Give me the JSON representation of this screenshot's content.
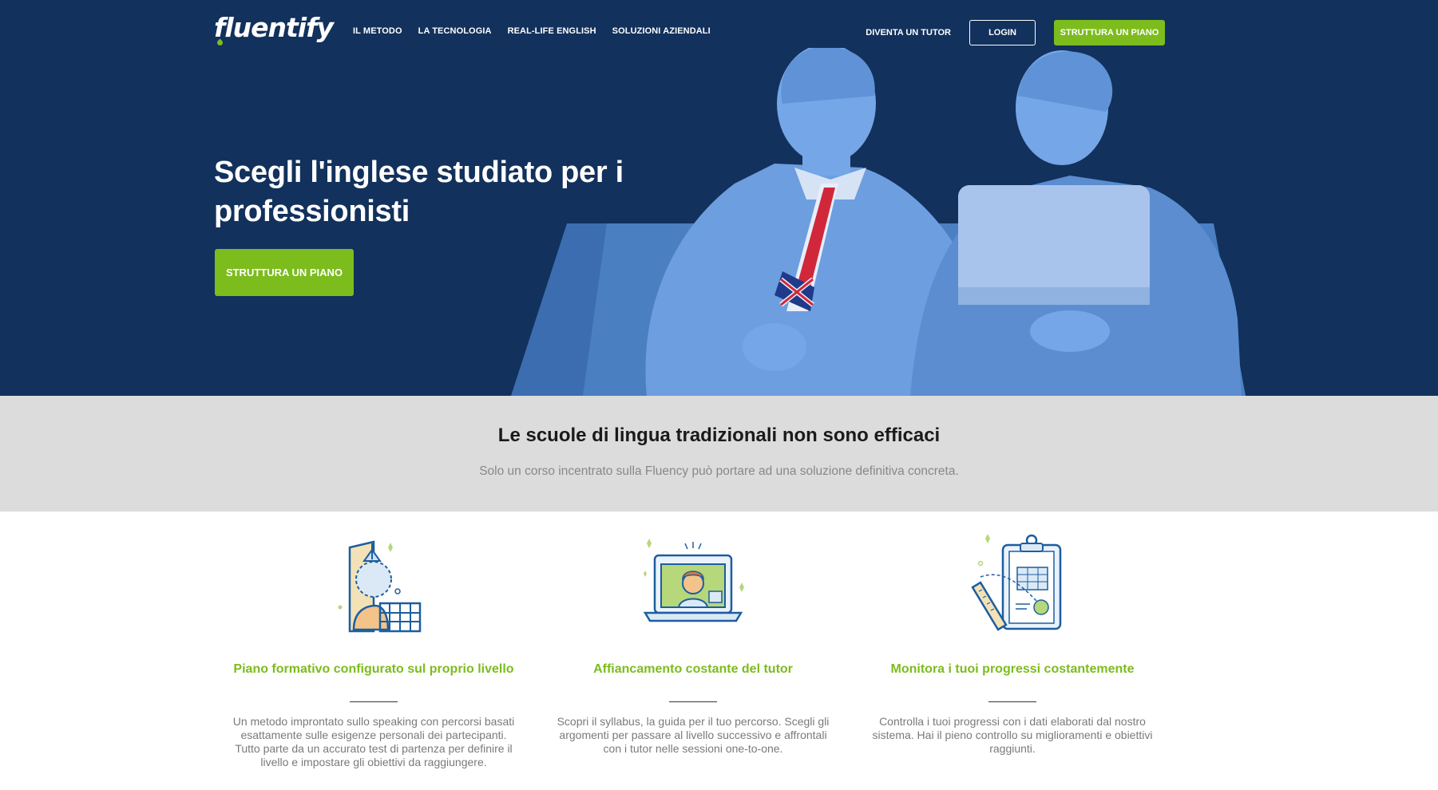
{
  "brand": {
    "logo_text": "fluentify",
    "accent_color": "#7cbc1d",
    "hero_bg_color": "#12315c"
  },
  "nav": {
    "links": [
      "IL METODO",
      "LA TECNOLOGIA",
      "REAL-LIFE ENGLISH",
      "SOLUZIONI AZIENDALI"
    ],
    "tutor_label": "DIVENTA UN TUTOR",
    "login_label": "LOGIN",
    "plan_label": "STRUTTURA UN PIANO"
  },
  "hero": {
    "title": "Scegli l'inglese studiato per i professionisti",
    "cta_label": "STRUTTURA UN PIANO",
    "image_icon": "businessmen-union-jack-tie-laptop"
  },
  "band": {
    "title": "Le scuole di lingua tradizionali non sono efficaci",
    "subtitle": "Solo un corso incentrato sulla Fluency può portare ad una soluzione definitiva concreta."
  },
  "features": [
    {
      "icon": "level-plan-illustration",
      "title": "Piano formativo configurato sul proprio livello",
      "text": "Un metodo improntato sullo speaking con percorsi basati esattamente sulle esigenze personali dei partecipanti. Tutto parte da un accurato test di partenza per definire il livello e impostare gli obiettivi da raggiungere."
    },
    {
      "icon": "tutor-laptop-illustration",
      "title": "Affiancamento costante del tutor",
      "text": "Scopri il syllabus, la guida per il tuo percorso. Scegli gli argomenti per passare al livello successivo e affrontali con i tutor nelle sessioni one-to-one."
    },
    {
      "icon": "progress-clipboard-illustration",
      "title": "Monitora i tuoi progressi costantemente",
      "text": "Controlla i tuoi progressi con i dati elaborati dal nostro sistema. Hai il pieno controllo su miglioramenti e obiettivi raggiunti."
    }
  ]
}
